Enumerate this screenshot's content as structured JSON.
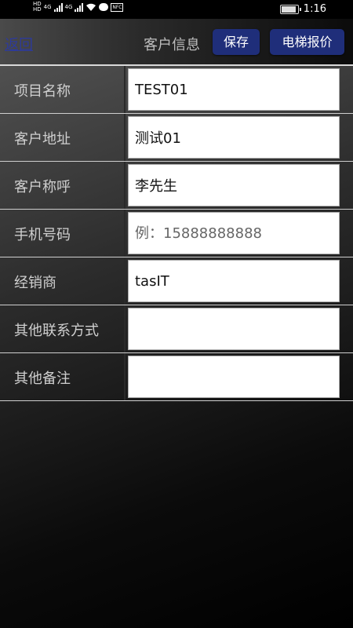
{
  "status_bar": {
    "hd1": "HD",
    "hd2": "HD",
    "net1": "4G",
    "net2": "4G",
    "battery_level": 0.9,
    "time": "1:16"
  },
  "header": {
    "back_label": "返回",
    "title": "客户信息",
    "save_label": "保存",
    "quote_label": "电梯报价"
  },
  "form": {
    "fields": [
      {
        "label": "项目名称",
        "value": "TEST01",
        "placeholder": ""
      },
      {
        "label": "客户地址",
        "value": "测试01",
        "placeholder": ""
      },
      {
        "label": "客户称呼",
        "value": "李先生",
        "placeholder": ""
      },
      {
        "label": "手机号码",
        "value": "",
        "placeholder": "例：15888888888"
      },
      {
        "label": "经销商",
        "value": "tasIT",
        "placeholder": ""
      },
      {
        "label": "其他联系方式",
        "value": "",
        "placeholder": ""
      },
      {
        "label": "其他备注",
        "value": "",
        "placeholder": ""
      }
    ]
  },
  "colors": {
    "button_bg": "#1f2e7a",
    "back_link": "#2d3a9b"
  }
}
